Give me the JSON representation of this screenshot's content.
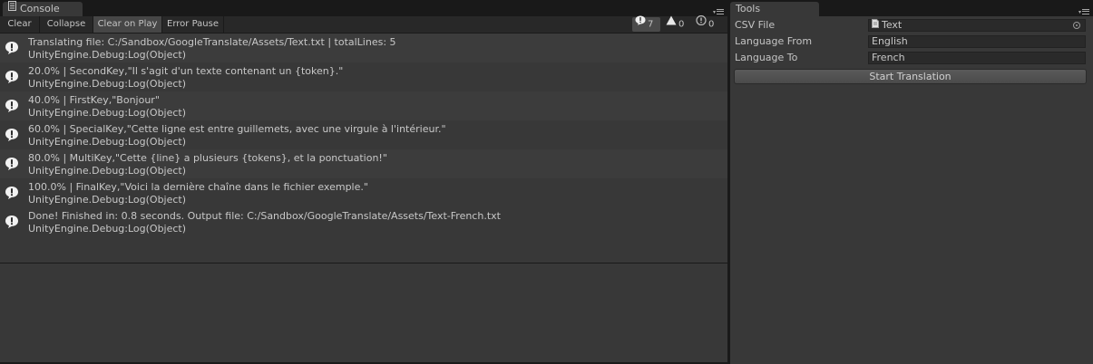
{
  "console": {
    "tab_title": "Console",
    "toolbar": {
      "clear": "Clear",
      "collapse": "Collapse",
      "clear_on_play": "Clear on Play",
      "error_pause": "Error Pause"
    },
    "counters": {
      "info": "7",
      "warning": "0",
      "error": "0"
    },
    "logs": [
      {
        "message": "Translating file: C:/Sandbox/GoogleTranslate/Assets/Text.txt | totalLines: 5",
        "trace": "UnityEngine.Debug:Log(Object)"
      },
      {
        "message": "20.0% | SecondKey,\"Il s'agit d'un texte contenant un {token}.\"",
        "trace": "UnityEngine.Debug:Log(Object)"
      },
      {
        "message": "40.0% | FirstKey,\"Bonjour\"",
        "trace": "UnityEngine.Debug:Log(Object)"
      },
      {
        "message": "60.0% | SpecialKey,\"Cette ligne est entre guillemets, avec une virgule à l'intérieur.\"",
        "trace": "UnityEngine.Debug:Log(Object)"
      },
      {
        "message": "80.0% | MultiKey,\"Cette {line} a plusieurs {tokens}, et la ponctuation!\"",
        "trace": "UnityEngine.Debug:Log(Object)"
      },
      {
        "message": "100.0% | FinalKey,\"Voici la dernière chaîne dans le fichier exemple.\"",
        "trace": "UnityEngine.Debug:Log(Object)"
      },
      {
        "message": "Done! Finished in: 0.8 seconds. Output file: C:/Sandbox/GoogleTranslate/Assets/Text-French.txt",
        "trace": "UnityEngine.Debug:Log(Object)"
      }
    ]
  },
  "tools": {
    "tab_title": "Tools",
    "csv_file_label": "CSV File",
    "csv_file_value": "Text",
    "language_from_label": "Language From",
    "language_from_value": "English",
    "language_to_label": "Language To",
    "language_to_value": "French",
    "start_button": "Start Translation"
  }
}
